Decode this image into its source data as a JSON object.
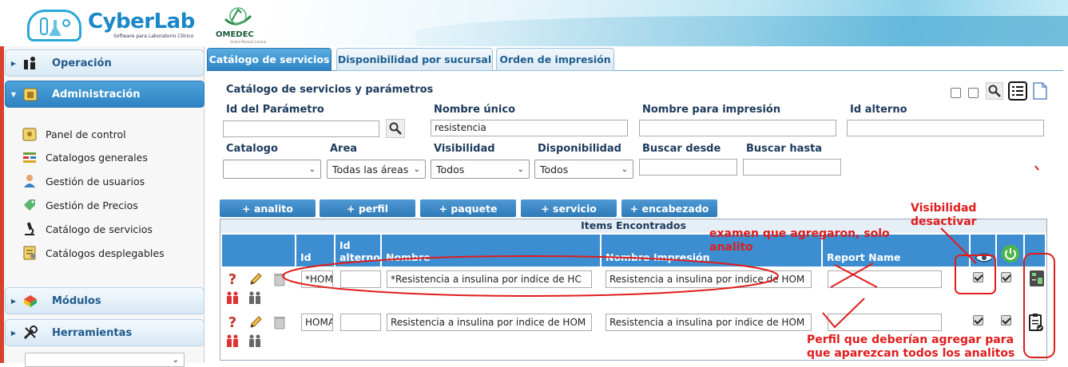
{
  "header": {
    "brand": "CyberLab",
    "brand_tagline": "Software para Laboratorio Clínico",
    "partner": "OMEDEC",
    "partner_tagline": "Online Medical Control"
  },
  "sidebar": {
    "sections": [
      {
        "label": "Operación"
      },
      {
        "label": "Administración"
      },
      {
        "label": "Módulos"
      },
      {
        "label": "Herramientas"
      }
    ],
    "items": [
      {
        "label": "Panel de control"
      },
      {
        "label": "Catalogos generales"
      },
      {
        "label": "Gestión de usuarios"
      },
      {
        "label": "Gestión de Precios"
      },
      {
        "label": "Catálogo de servicios"
      },
      {
        "label": "Catálogos desplegables"
      }
    ]
  },
  "tabs": [
    {
      "label": "Catálogo de servicios",
      "active": true
    },
    {
      "label": "Disponibilidad por sucursal",
      "active": false
    },
    {
      "label": "Orden de impresión",
      "active": false
    }
  ],
  "form": {
    "title": "Catálogo de servicios y parámetros",
    "id_parametro_label": "Id del Parámetro",
    "id_parametro_value": "",
    "nombre_unico_label": "Nombre único",
    "nombre_unico_value": "resistencia",
    "nombre_impresion_label": "Nombre para impresión",
    "nombre_impresion_value": "",
    "id_alterno_label": "Id alterno",
    "id_alterno_value": "",
    "catalogo_label": "Catalogo",
    "catalogo_value": "",
    "area_label": "Area",
    "area_value": "Todas las áreas",
    "visibilidad_label": "Visibilidad",
    "visibilidad_value": "Todos",
    "disponibilidad_label": "Disponibilidad",
    "disponibilidad_value": "Todos",
    "buscar_desde_label": "Buscar desde",
    "buscar_desde_value": "",
    "buscar_hasta_label": "Buscar hasta",
    "buscar_hasta_value": ""
  },
  "add_buttons": [
    "+ analito",
    "+ perfil",
    "+ paquete",
    "+ servicio",
    "+ encabezado"
  ],
  "table": {
    "caption": "Items Encontrados",
    "headers": {
      "id": "Id",
      "id_alterno": "Id alterno",
      "nombre": "Nombre",
      "nombre_impresion": "Nombre Impresión",
      "report_name": "Report Name"
    },
    "rows": [
      {
        "id": "*HOM",
        "id_alterno": "",
        "nombre": "*Resistencia a insulina por indice de HC",
        "nombre_impresion": "Resistencia a insulina por indice de HOM",
        "report_name": "",
        "visible": true,
        "active": true,
        "type_icon": "analyte-icon"
      },
      {
        "id": "HOMA",
        "id_alterno": "",
        "nombre": "Resistencia a insulina por indice de HOM",
        "nombre_impresion": "Resistencia a insulina por indice de HOM",
        "report_name": "",
        "visible": true,
        "active": true,
        "type_icon": "clipboard-check-icon"
      }
    ]
  },
  "annotations": {
    "note1": "examen que agregaron,  solo analito",
    "note2": "Visibilidad desactivar",
    "note3": "Perfil que deberían agregar para que aparezcan todos los analitos"
  },
  "colors": {
    "accent": "#3d8ed0",
    "annotation": "#e01c1c",
    "sidebar_active": "#2d82c1"
  }
}
